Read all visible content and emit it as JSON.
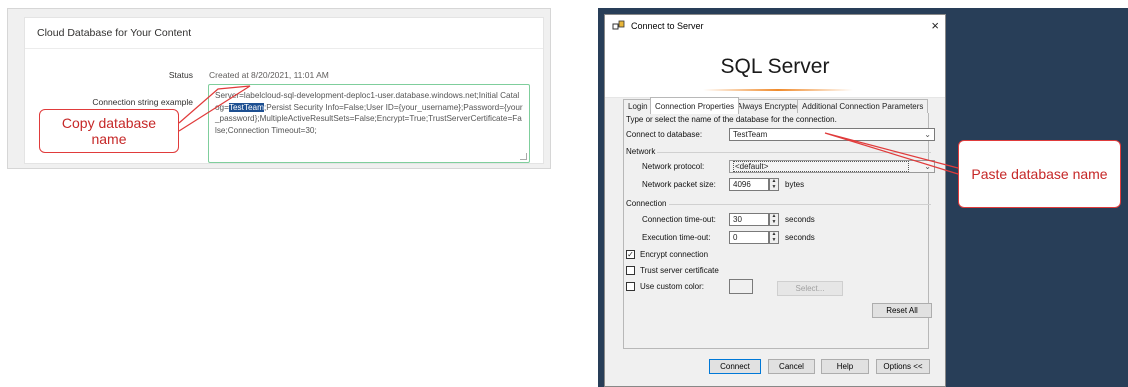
{
  "web": {
    "title": "Cloud Database for Your Content",
    "status_label": "Status",
    "status_value": "Created at 8/20/2021, 11:01 AM",
    "conn_label": "Connection string example",
    "conn_before": "Server=labelcloud-sql-development-deploc1-user.database.windows.net;Initial Catalog=",
    "conn_db": "TestTeam",
    "conn_after": ";Persist Security Info=False;User ID={your_username};Password={your_password};MultipleActiveResultSets=False;Encrypt=True;TrustServerCertificate=False;Connection Timeout=30;"
  },
  "callouts": {
    "copy": "Copy database name",
    "paste": "Paste database name"
  },
  "dialog": {
    "title": "Connect to Server",
    "close": "×",
    "banner": "SQL Server",
    "tabs": [
      "Login",
      "Connection Properties",
      "Always Encrypted",
      "Additional Connection Parameters"
    ],
    "instruction": "Type or select the name of the database for the connection.",
    "connect_db_label": "Connect to database:",
    "connect_db_value": "TestTeam",
    "network_group": "Network",
    "protocol_label": "Network protocol:",
    "protocol_value": "<default>",
    "packet_label": "Network packet size:",
    "packet_value": "4096",
    "packet_unit": "bytes",
    "connection_group": "Connection",
    "conn_timeout_label": "Connection time-out:",
    "conn_timeout_value": "30",
    "exec_timeout_label": "Execution time-out:",
    "exec_timeout_value": "0",
    "seconds": "seconds",
    "encrypt_label": "Encrypt connection",
    "encrypt_checked": true,
    "trust_label": "Trust server certificate",
    "custom_color_label": "Use custom color:",
    "select_btn": "Select...",
    "reset_btn": "Reset All",
    "buttons": {
      "connect": "Connect",
      "cancel": "Cancel",
      "help": "Help",
      "options": "Options <<"
    }
  },
  "colors": {
    "accent_red": "#e03b3b",
    "dark_bg": "#283e58",
    "highlight": "#1d4f91",
    "green_border": "#7fce9c"
  }
}
